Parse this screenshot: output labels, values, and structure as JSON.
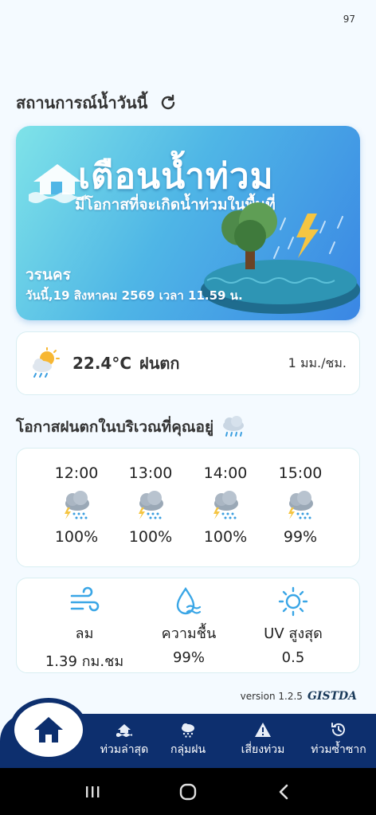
{
  "status_bar": {
    "battery": "97"
  },
  "section_title": "สถานการณ์น้ำวันนี้",
  "alert": {
    "title": "เตือนน้ำท่วม",
    "subtitle": "มีโอกาสที่จะเกิดน้ำท่วมในพื้นที่",
    "place": "วรนคร",
    "datetime": "วันนี้,19 สิงหาคม 2569 เวลา 11.59 น.",
    "gradient_start": "#7fe3e8",
    "gradient_end": "#3a86e4"
  },
  "current": {
    "icon": "sun-cloud-rain-icon",
    "temperature": "22.4°C",
    "condition": "ฝนตก",
    "rainfall": "1 มม./ชม."
  },
  "rain_chance_title": "โอกาสฝนตกในบริเวณที่คุณอยู่",
  "hourly": [
    {
      "time": "12:00",
      "icon": "thunderstorm-icon",
      "chance": "100%"
    },
    {
      "time": "13:00",
      "icon": "thunderstorm-icon",
      "chance": "100%"
    },
    {
      "time": "14:00",
      "icon": "thunderstorm-icon",
      "chance": "100%"
    },
    {
      "time": "15:00",
      "icon": "thunderstorm-icon",
      "chance": "99%"
    }
  ],
  "conditions": [
    {
      "icon": "wind-icon",
      "label": "ลม",
      "value": "1.39 กม.ชม"
    },
    {
      "icon": "humidity-icon",
      "label": "ความชื้น",
      "value": "99%"
    },
    {
      "icon": "uv-sun-icon",
      "label": "UV สูงสุด",
      "value": "0.5"
    }
  ],
  "version": "version 1.2.5",
  "brand": "GISTDA",
  "nav": {
    "home_icon": "home-icon",
    "items": [
      {
        "label": "ท่วมล่าสุด",
        "icon": "flood-house-icon"
      },
      {
        "label": "กลุ่มฝน",
        "icon": "rain-cloud-icon"
      },
      {
        "label": "เสี่ยงท่วม",
        "icon": "warning-icon"
      },
      {
        "label": "ท่วมซ้ำซาก",
        "icon": "history-icon"
      }
    ]
  },
  "colors": {
    "nav_background": "#0d2f6e",
    "accent": "#3a86e4",
    "page_background": "#f4faff"
  }
}
